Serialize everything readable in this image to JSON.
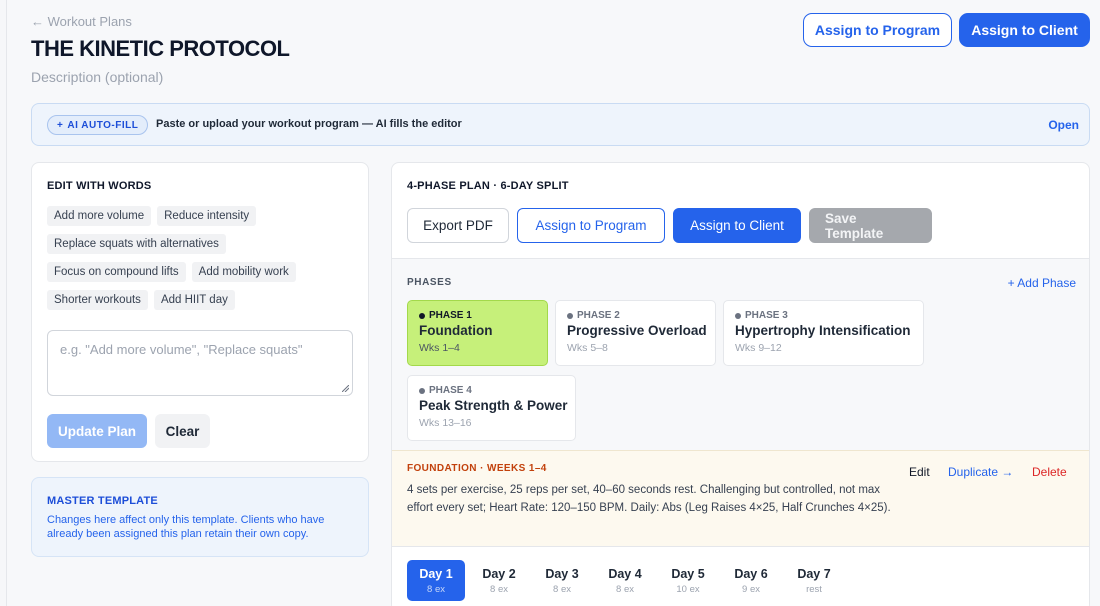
{
  "header": {
    "back_label": "← Workout Plans",
    "title": "THE KINETIC PROTOCOL",
    "description_placeholder": "Description (optional)",
    "assign_program_label": "Assign to Program",
    "assign_client_label": "Assign to Client"
  },
  "ai_autofill": {
    "badge_label": "AI AUTO-FILL",
    "badge_icon": "+",
    "message": "Paste or upload your workout program — AI fills the editor",
    "open_label": "Open"
  },
  "edit_words": {
    "title": "EDIT WITH WORDS",
    "chip_rows": [
      [
        "Add more volume",
        "Reduce intensity"
      ],
      [
        "Replace squats with alternatives"
      ],
      [
        "Focus on compound lifts",
        "Add mobility work"
      ],
      [
        "Shorter workouts",
        "Add HIIT day"
      ]
    ],
    "input_placeholder": "e.g. \"Add more volume\", \"Replace squats\"",
    "update_label": "Update Plan",
    "clear_label": "Clear"
  },
  "master_template": {
    "title": "MASTER TEMPLATE",
    "text": "Changes here affect only this template. Clients who have already been assigned this plan retain their own copy."
  },
  "plan": {
    "title": "4-PHASE PLAN · 6-DAY SPLIT",
    "actions": {
      "export": "Export PDF",
      "assign_program": "Assign to Program",
      "assign_client": "Assign to Client",
      "save_template": "Save Template"
    },
    "phases_label": "PHASES",
    "add_phase_label": "+ Add Phase",
    "phases": [
      {
        "tag": "PHASE 1",
        "name": "Foundation",
        "weeks": "Wks 1–4",
        "active": true
      },
      {
        "tag": "PHASE 2",
        "name": "Progressive Overload",
        "weeks": "Wks 5–8",
        "active": false
      },
      {
        "tag": "PHASE 3",
        "name": "Hypertrophy Intensification",
        "weeks": "Wks 9–12",
        "active": false
      },
      {
        "tag": "PHASE 4",
        "name": "Peak Strength & Power",
        "weeks": "Wks 13–16",
        "active": false
      }
    ],
    "detail": {
      "title": "FOUNDATION · WEEKS 1–4",
      "text": "4 sets per exercise, 25 reps per set, 40–60 seconds rest. Challenging but controlled, not max effort every set; Heart Rate: 120–150 BPM. Daily: Abs (Leg Raises 4×25, Half Crunches 4×25).",
      "edit_label": "Edit",
      "duplicate_label": "Duplicate →",
      "delete_label": "Delete"
    },
    "days": [
      {
        "name": "Day 1",
        "sub": "8 ex",
        "active": true
      },
      {
        "name": "Day 2",
        "sub": "8 ex",
        "active": false
      },
      {
        "name": "Day 3",
        "sub": "8 ex",
        "active": false
      },
      {
        "name": "Day 4",
        "sub": "8 ex",
        "active": false
      },
      {
        "name": "Day 5",
        "sub": "10 ex",
        "active": false
      },
      {
        "name": "Day 6",
        "sub": "9 ex",
        "active": false
      },
      {
        "name": "Day 7",
        "sub": "rest",
        "active": false
      }
    ]
  },
  "colors": {
    "primary": "#2563eb",
    "active_phase": "#c6f07a",
    "danger": "#dc2626",
    "phase_detail_title": "#c2410c"
  }
}
